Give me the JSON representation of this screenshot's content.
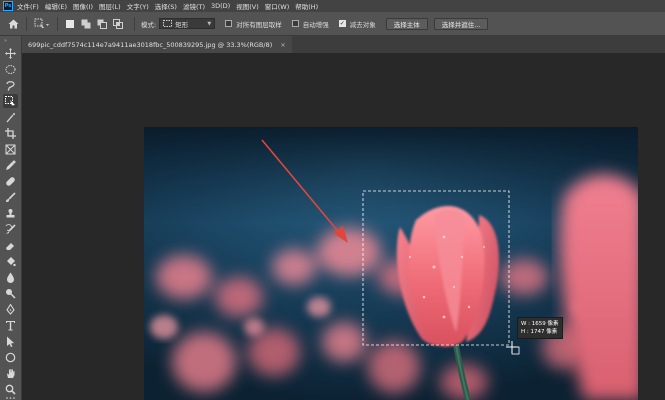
{
  "app": {
    "logo_text": "Ps"
  },
  "menu": [
    "文件(F)",
    "编辑(E)",
    "图像(I)",
    "图层(L)",
    "文字(Y)",
    "选择(S)",
    "滤镜(T)",
    "3D(D)",
    "视图(V)",
    "窗口(W)",
    "帮助(H)"
  ],
  "options": {
    "mode_label": "模式:",
    "mode_value": "矩形",
    "sample_all_layers": {
      "label": "对所有图层取样",
      "checked": false
    },
    "auto_enhance": {
      "label": "自动增强",
      "checked": false
    },
    "subtract_target": {
      "label": "减去对象",
      "checked": true
    },
    "select_subject_label": "选择主体",
    "select_mask_label": "选择并遮住..."
  },
  "document": {
    "tab_title": "699pic_cddf7574c114e7a9411ae3018fbc_500839295.jpg @ 33.3%(RGB/8)",
    "close_glyph": "×"
  },
  "selection_readout": {
    "width_line": "W : 1659 像素",
    "height_line": "H : 1747 像素"
  },
  "colors": {
    "accent_arrow": "#e0463c",
    "ps_blue": "#31a8ff",
    "tulip_pink": "#ee6f78",
    "background_teal": "#1e4a66"
  },
  "tools": [
    "move-tool-icon",
    "marquee-tool-icon",
    "lasso-tool-icon",
    "object-selection-tool-icon",
    "magic-wand-tool-icon",
    "crop-tool-icon",
    "frame-tool-icon",
    "eyedropper-tool-icon",
    "spot-healing-tool-icon",
    "brush-tool-icon",
    "clone-stamp-tool-icon",
    "history-brush-tool-icon",
    "eraser-tool-icon",
    "paint-bucket-tool-icon",
    "blur-tool-icon",
    "dodge-tool-icon",
    "pen-tool-icon",
    "type-tool-icon",
    "path-selection-tool-icon",
    "rectangle-tool-icon",
    "hand-tool-icon",
    "zoom-tool-icon",
    "more-tools-icon"
  ]
}
